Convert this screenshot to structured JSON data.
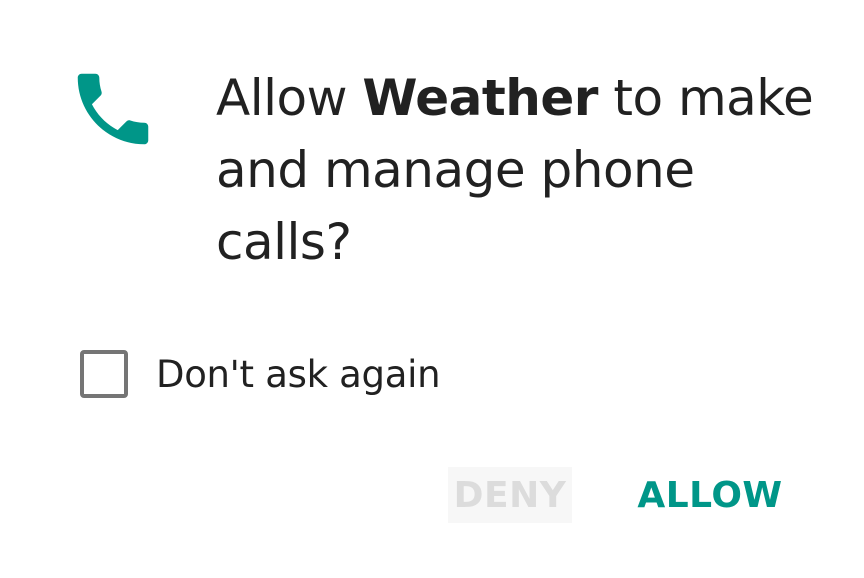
{
  "dialog": {
    "icon": "phone-icon",
    "title_prefix": "Allow ",
    "app_name": "Weather",
    "title_suffix": " to make and manage phone calls?",
    "checkbox": {
      "label": "Don't ask again",
      "checked": false
    },
    "buttons": {
      "deny_label": "DENY",
      "allow_label": "ALLOW"
    }
  },
  "colors": {
    "accent": "#009688",
    "text": "#212121",
    "checkbox_border": "#757575",
    "deny_text": "#dcdcdc",
    "deny_background": "#f7f7f7"
  }
}
